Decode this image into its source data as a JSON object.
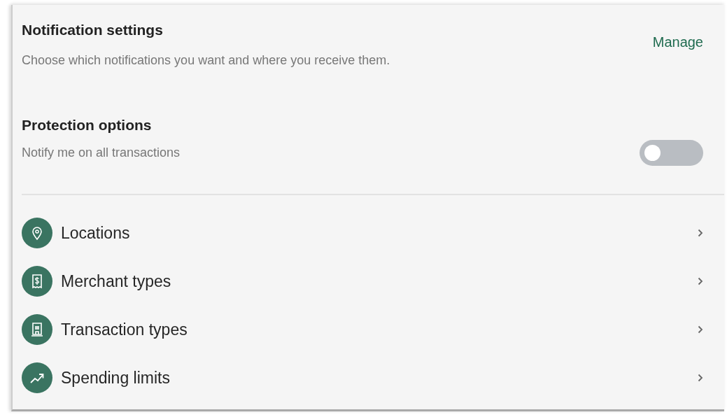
{
  "notification_settings": {
    "title": "Notification settings",
    "description": "Choose which notifications you want and where you receive them.",
    "manage_link": "Manage"
  },
  "protection_options": {
    "title": "Protection options",
    "setting": {
      "label": "Notify me on all transactions",
      "on": false
    }
  },
  "menu_items": [
    {
      "label": "Locations"
    },
    {
      "label": "Merchant types"
    },
    {
      "label": "Transaction types"
    },
    {
      "label": "Spending limits"
    }
  ]
}
